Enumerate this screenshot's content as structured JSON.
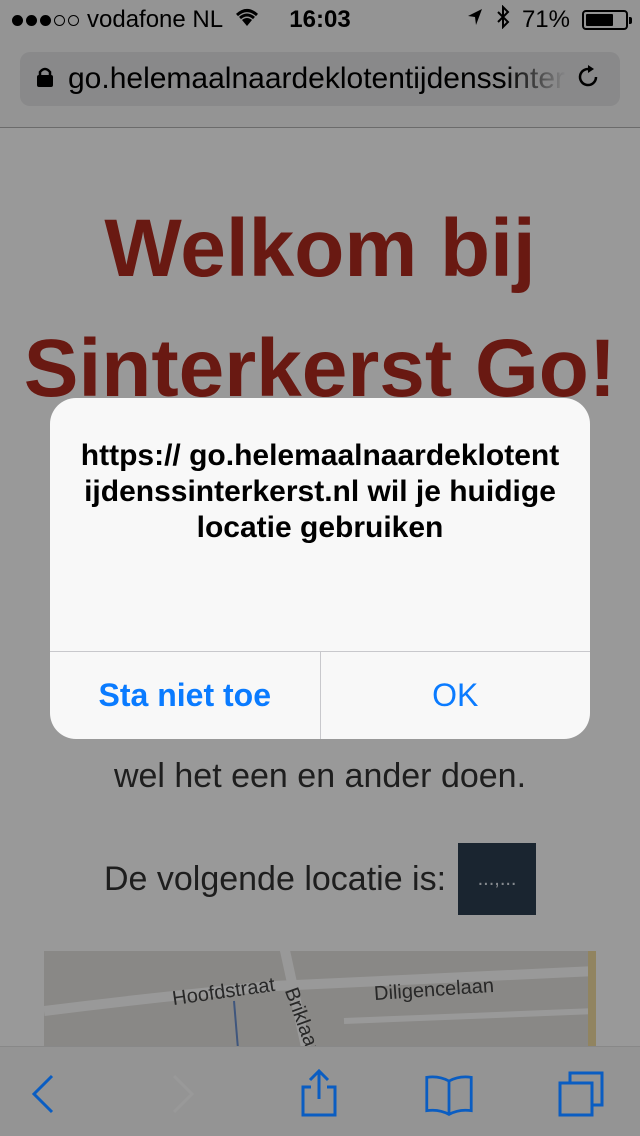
{
  "status_bar": {
    "carrier": "vodafone NL",
    "time": "16:03",
    "battery_percent": "71%",
    "battery_level": 0.71,
    "signal_bars": 3,
    "signal_total": 5
  },
  "browser": {
    "url": "go.helemaalnaardeklotentijdenssinterkerst.nl"
  },
  "page": {
    "title": "Welkom bij Sinterkerst Go!",
    "text": "wel het een en ander doen.",
    "location_label": "De volgende locatie is:",
    "location_value": "...,...",
    "map": {
      "streets": [
        "Hoofdstraat",
        "Briklaan",
        "Diligencelaan"
      ]
    }
  },
  "alert": {
    "message": "https:// go.helemaalnaardeklotentijdenssinterkerst.nl wil je huidige locatie gebruiken",
    "deny_label": "Sta niet toe",
    "ok_label": "OK"
  },
  "colors": {
    "accent": "#0a7bff",
    "title_red": "#b02a1f"
  },
  "toolbar": {
    "icons": [
      "back-icon",
      "forward-icon",
      "share-icon",
      "bookmarks-icon",
      "tabs-icon"
    ]
  }
}
